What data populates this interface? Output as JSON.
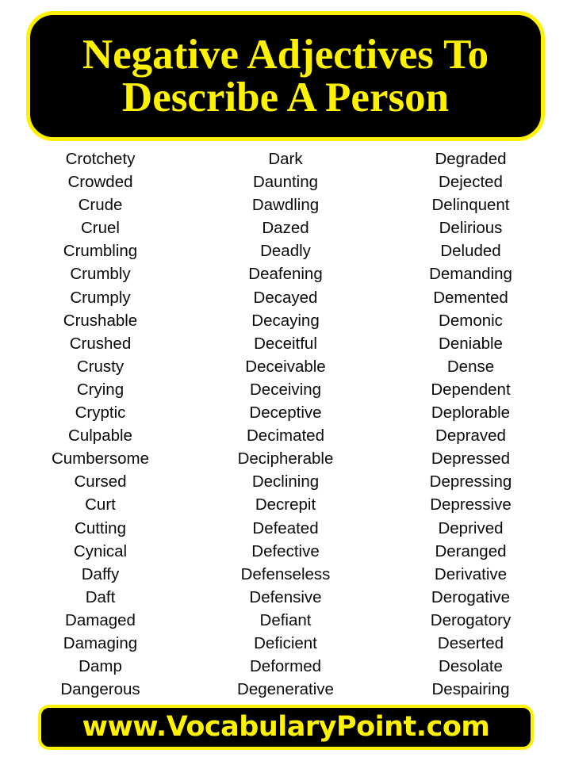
{
  "header": {
    "title_line_1": "Negative Adjectives To",
    "title_line_2": "Describe A Person",
    "background_color": "#000000",
    "border_color": "#FFF200",
    "text_color": "#FFF200"
  },
  "columns": [
    {
      "words": [
        "Crotchety",
        "Crowded",
        "Crude",
        "Cruel",
        "Crumbling",
        "Crumbly",
        "Crumply",
        "Crushable",
        "Crushed",
        "Crusty",
        "Crying",
        "Cryptic",
        "Culpable",
        "Cumbersome",
        "Cursed",
        "Curt",
        "Cutting",
        "Cynical",
        "Daffy",
        "Daft",
        "Damaged",
        "Damaging",
        "Damp",
        "Dangerous"
      ]
    },
    {
      "words": [
        "Dark",
        "Daunting",
        "Dawdling",
        "Dazed",
        "Deadly",
        "Deafening",
        "Decayed",
        "Decaying",
        "Deceitful",
        "Deceivable",
        "Deceiving",
        "Deceptive",
        "Decimated",
        "Decipherable",
        "Declining",
        "Decrepit",
        "Defeated",
        "Defective",
        "Defenseless",
        "Defensive",
        "Defiant",
        "Deficient",
        "Deformed",
        "Degenerative"
      ]
    },
    {
      "words": [
        "Degraded",
        "Dejected",
        "Delinquent",
        "Delirious",
        "Deluded",
        "Demanding",
        "Demented",
        "Demonic",
        "Deniable",
        "Dense",
        "Dependent",
        "Deplorable",
        "Depraved",
        "Depressed",
        "Depressing",
        "Depressive",
        "Deprived",
        "Deranged",
        "Derivative",
        "Derogative",
        "Derogatory",
        "Deserted",
        "Desolate",
        "Despairing"
      ]
    }
  ],
  "footer": {
    "website": "www.VocabularyPoint.com",
    "background_color": "#000000",
    "border_color": "#FFF200",
    "text_color": "#FFF200"
  }
}
